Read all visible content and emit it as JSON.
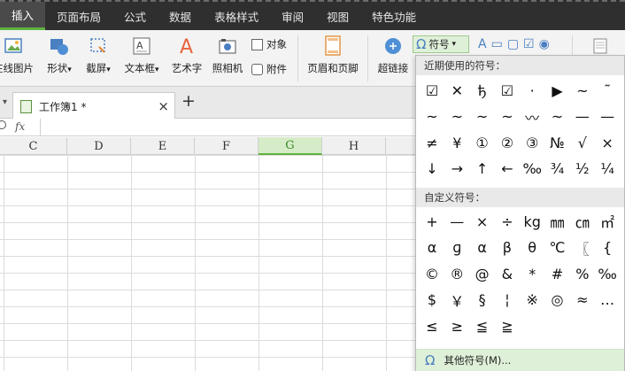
{
  "menu": {
    "tabs": [
      "插入",
      "页面布局",
      "公式",
      "数据",
      "表格样式",
      "审阅",
      "视图",
      "特色功能"
    ],
    "active_index": 0
  },
  "ribbon": {
    "online_picture": "在线图片",
    "shapes": "形状",
    "screenshot": "截屏",
    "textbox": "文本框",
    "wordart": "艺术字",
    "camera": "照相机",
    "object": "对象",
    "attachment": "附件",
    "header_footer": "页眉和页脚",
    "hyperlink": "超链接",
    "symbol": "符号",
    "symbol_glyph": "Ω",
    "dropdown_arrow": "▾",
    "extra_icons": [
      "A",
      "▭",
      "▢",
      "☑",
      "◉"
    ]
  },
  "workbook": {
    "tab_name": "工作簿1 *",
    "close_glyph": "×",
    "new_tab_glyph": "+",
    "tab_arrow": "▾"
  },
  "formula_bar": {
    "fx_label": "fx",
    "value": ""
  },
  "columns": [
    "C",
    "D",
    "E",
    "F",
    "G",
    "H"
  ],
  "selected_column": "G",
  "colors": {
    "menubar": "#2f2f2f",
    "accent_green": "#5fb33f",
    "selected_col_bg": "#d6ecc8",
    "selected_col_text": "#3a8a2a",
    "highlight_bg": "#dff0d8"
  },
  "symbol_panel": {
    "recent_title": "近期使用的符号：",
    "recent": [
      [
        "☑",
        "✕",
        "ђ",
        "☑",
        "·",
        "▶",
        "~",
        "˜"
      ],
      [
        "~",
        "~",
        "~",
        "~",
        "〰",
        "~",
        "—",
        "—"
      ],
      [
        "≠",
        "¥",
        "①",
        "②",
        "③",
        "№",
        "√",
        "×"
      ],
      [
        "↓",
        "→",
        "↑",
        "←",
        "‰",
        "¾",
        "½",
        "¼"
      ]
    ],
    "custom_title": "自定义符号：",
    "custom": [
      [
        "+",
        "—",
        "×",
        "÷",
        "kg",
        "㎜",
        "㎝",
        "㎡"
      ],
      [
        "α",
        "ɡ",
        "α",
        "β",
        "θ",
        "℃",
        "〖",
        "{"
      ],
      [
        "©",
        "®",
        "@",
        "&",
        "*",
        "#",
        "%",
        "‰"
      ],
      [
        "$",
        "￥",
        "§",
        "¦",
        "※",
        "◎",
        "≈",
        "…"
      ],
      [
        "≤",
        "≥",
        "≦",
        "≧"
      ]
    ],
    "more_label": "其他符号(M)..."
  }
}
